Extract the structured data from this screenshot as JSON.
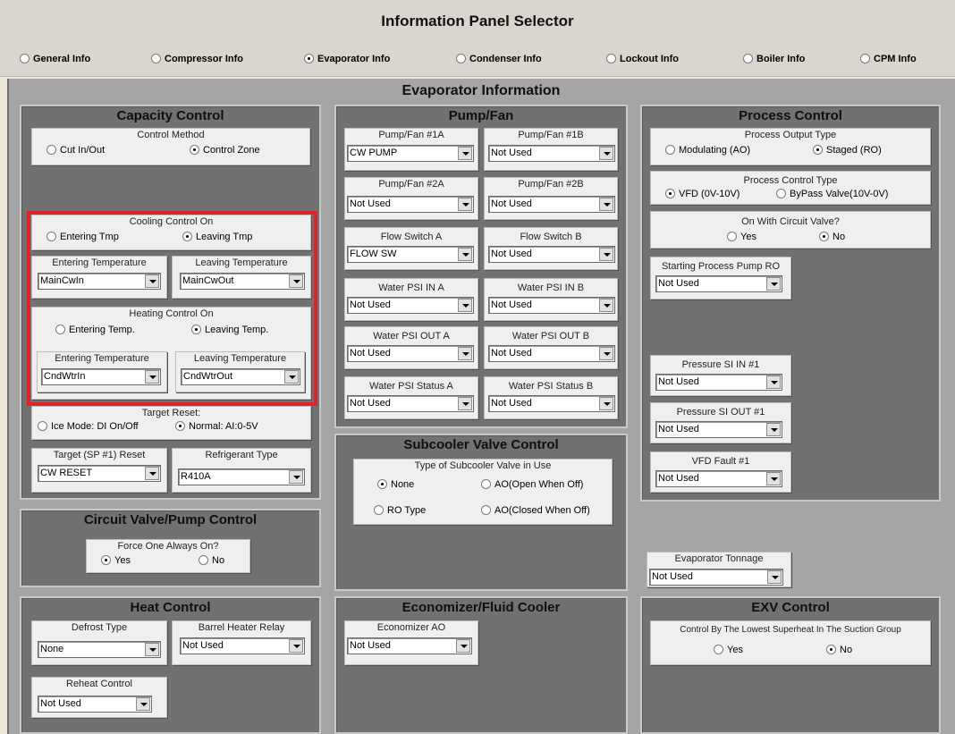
{
  "header": {
    "title": "Information Panel Selector",
    "options": [
      {
        "label": "General Info",
        "selected": false
      },
      {
        "label": "Compressor Info",
        "selected": false
      },
      {
        "label": "Evaporator Info",
        "selected": true
      },
      {
        "label": "Condenser Info",
        "selected": false
      },
      {
        "label": "Lockout Info",
        "selected": false
      },
      {
        "label": "Boiler Info",
        "selected": false
      },
      {
        "label": "CPM Info",
        "selected": false
      }
    ]
  },
  "section_title": "Evaporator Information",
  "capacity": {
    "title": "Capacity Control",
    "control_method": {
      "title": "Control Method",
      "opt1": "Cut In/Out",
      "opt2": "Control Zone"
    },
    "cooling": {
      "title": "Cooling Control On",
      "opt1": "Entering Tmp",
      "opt2": "Leaving Tmp"
    },
    "cool_enter": {
      "label": "Entering Temperature",
      "value": "MainCwIn"
    },
    "cool_leave": {
      "label": "Leaving Temperature",
      "value": "MainCwOut"
    },
    "heating": {
      "title": "Heating Control On",
      "opt1": "Entering Temp.",
      "opt2": "Leaving Temp."
    },
    "heat_enter": {
      "label": "Entering Temperature",
      "value": "CndWtrIn"
    },
    "heat_leave": {
      "label": "Leaving Temperature",
      "value": "CndWtrOut"
    },
    "target_reset": {
      "title": "Target Reset:",
      "opt1": "Ice Mode: DI On/Off",
      "opt2": "Normal: AI:0-5V"
    },
    "target_sp": {
      "label": "Target (SP #1) Reset",
      "value": "CW RESET"
    },
    "refrigerant": {
      "label": "Refrigerant Type",
      "value": "R410A"
    }
  },
  "circuit": {
    "title": "Circuit Valve/Pump Control",
    "force": {
      "title": "Force One Always On?",
      "opt1": "Yes",
      "opt2": "No"
    }
  },
  "heat": {
    "title": "Heat Control",
    "defrost": {
      "label": "Defrost Type",
      "value": "None"
    },
    "barrel": {
      "label": "Barrel Heater Relay",
      "value": "Not Used"
    },
    "reheat": {
      "label": "Reheat Control",
      "value": "Not Used"
    }
  },
  "pump": {
    "title": "Pump/Fan",
    "p1a": {
      "label": "Pump/Fan #1A",
      "value": "CW PUMP"
    },
    "p1b": {
      "label": "Pump/Fan #1B",
      "value": "Not Used"
    },
    "p2a": {
      "label": "Pump/Fan #2A",
      "value": "Not Used"
    },
    "p2b": {
      "label": "Pump/Fan #2B",
      "value": "Not Used"
    },
    "fsa": {
      "label": "Flow Switch A",
      "value": "FLOW SW"
    },
    "fsb": {
      "label": "Flow Switch B",
      "value": "Not Used"
    },
    "wpia": {
      "label": "Water PSI IN A",
      "value": "Not Used"
    },
    "wpib": {
      "label": "Water PSI IN B",
      "value": "Not Used"
    },
    "wpoa": {
      "label": "Water PSI OUT A",
      "value": "Not Used"
    },
    "wpob": {
      "label": "Water PSI OUT B",
      "value": "Not Used"
    },
    "wpsa": {
      "label": "Water PSI Status A",
      "value": "Not Used"
    },
    "wpsb": {
      "label": "Water PSI Status B",
      "value": "Not Used"
    }
  },
  "subcooler": {
    "title": "Subcooler Valve Control",
    "type": {
      "title": "Type of Subcooler Valve in Use",
      "opt1": "None",
      "opt2": "AO(Open When Off)",
      "opt3": "RO Type",
      "opt4": "AO(Closed When Off)"
    }
  },
  "economizer": {
    "title": "Economizer/Fluid Cooler",
    "ao": {
      "label": "Economizer AO",
      "value": "Not Used"
    }
  },
  "process": {
    "title": "Process Control",
    "output_type": {
      "title": "Process Output Type",
      "opt1": "Modulating (AO)",
      "opt2": "Staged (RO)"
    },
    "control_type": {
      "title": "Process Control Type",
      "opt1": "VFD (0V-10V)",
      "opt2": "ByPass Valve(10V-0V)"
    },
    "circuit_valve": {
      "title": "On With Circuit Valve?",
      "opt1": "Yes",
      "opt2": "No"
    },
    "pump_ro": {
      "label": "Starting Process Pump RO",
      "value": "Not Used"
    },
    "psi_in": {
      "label": "Pressure SI IN #1",
      "value": "Not Used"
    },
    "psi_out": {
      "label": "Pressure SI OUT #1",
      "value": "Not Used"
    },
    "vfd_fault": {
      "label": "VFD Fault #1",
      "value": "Not Used"
    }
  },
  "tonnage": {
    "label": "Evaporator Tonnage",
    "value": "Not Used"
  },
  "exv": {
    "title": "EXV Control",
    "lowest": {
      "title": "Control By The Lowest Superheat In The Suction Group",
      "opt1": "Yes",
      "opt2": "No"
    }
  }
}
